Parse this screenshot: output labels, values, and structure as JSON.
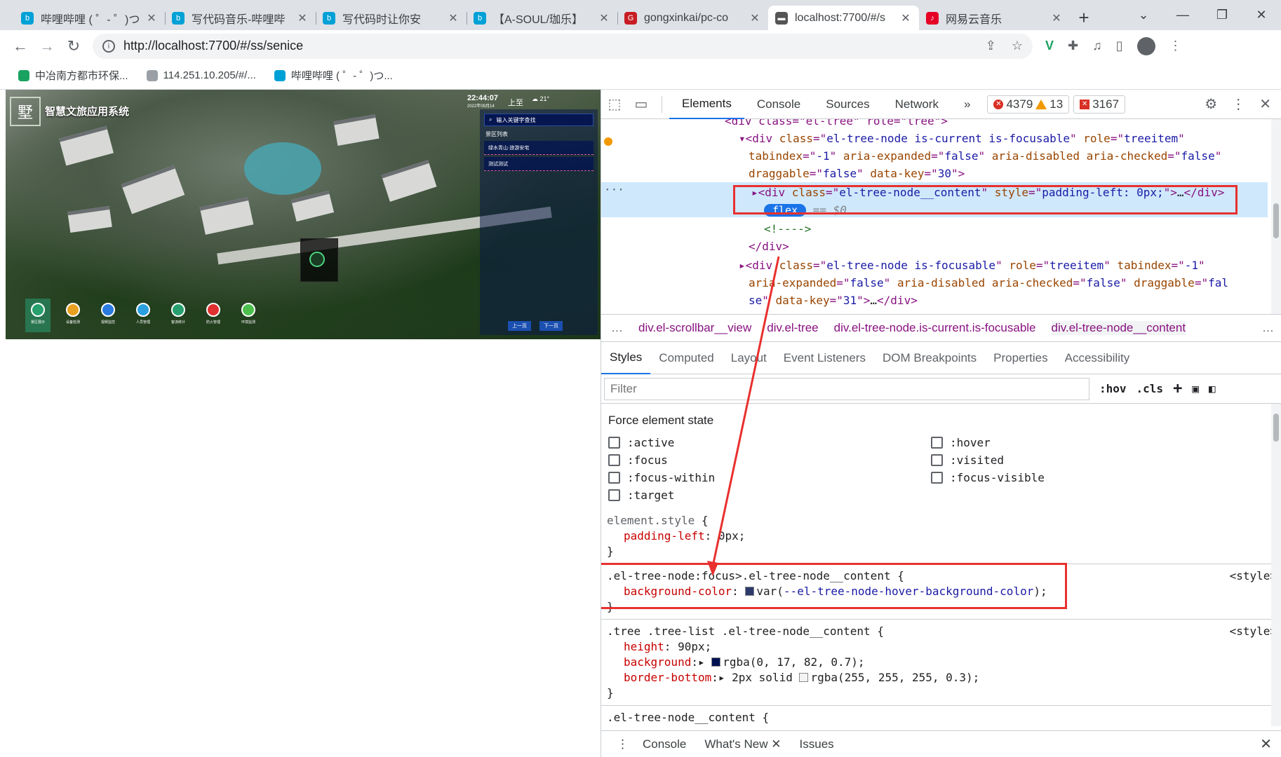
{
  "tabs": [
    {
      "title": "哔哩哔哩 ( ゜- ゜)つ",
      "fav_color": "#00a1d6",
      "fav": "b"
    },
    {
      "title": "写代码音乐-哔哩哔",
      "fav_color": "#00a1d6",
      "fav": "b"
    },
    {
      "title": "写代码时让你安",
      "fav_color": "#00a1d6",
      "fav": "b"
    },
    {
      "title": "【A-SOUL/珈乐】",
      "fav_color": "#00a1d6",
      "fav": "b"
    },
    {
      "title": "gongxinkai/pc-co",
      "fav_color": "#c71d23",
      "fav": "G"
    },
    {
      "title": "localhost:7700/#/s",
      "fav_color": "#555555",
      "fav": "▬"
    },
    {
      "title": "网易云音乐",
      "fav_color": "#e60026",
      "fav": "♪"
    }
  ],
  "active_tab": 5,
  "url": "http://localhost:7700/#/ss/senice",
  "bookmarks": [
    {
      "label": "中冶南方都市环保...",
      "color": "#1aa260"
    },
    {
      "label": "114.251.10.205/#/...",
      "color": "#9aa0a6"
    },
    {
      "label": "哔哩哔哩 ( ゜- ゜)つ...",
      "color": "#00a1d6"
    }
  ],
  "app": {
    "title": "智慧文旅应用系统",
    "time": "22:44:07",
    "date": "2022年09月14",
    "ampm": "上至",
    "temp": "21°",
    "search_placeholder": "输入关键字查找",
    "list_title": "景区列表",
    "list_items": [
      "绿水青山·旅游安宅",
      "测试测试"
    ],
    "prev": "上一页",
    "next": "下一页",
    "dock": [
      "景区展示",
      "设备检测",
      "视频监控",
      "人员管理",
      "客流统计",
      "防火管理",
      "环境监测"
    ]
  },
  "devtools": {
    "tabs": [
      "Elements",
      "Console",
      "Sources",
      "Network"
    ],
    "errors": "4379",
    "warnings": "13",
    "issues": "3167",
    "breadcrumbs": [
      "div.el-scrollbar__view",
      "div.el-tree",
      "div.el-tree-node.is-current.is-focusable",
      "div.el-tree-node__content"
    ],
    "style_tabs": [
      "Styles",
      "Computed",
      "Layout",
      "Event Listeners",
      "DOM Breakpoints",
      "Properties",
      "Accessibility"
    ],
    "filter_placeholder": "Filter",
    "hov": ":hov",
    "cls": ".cls",
    "force_state_title": "Force element state",
    "states": [
      ":active",
      ":hover",
      ":focus",
      ":visited",
      ":focus-within",
      ":focus-visible",
      ":target"
    ],
    "drawer": [
      "Console",
      "What's New",
      "Issues"
    ],
    "source_label": "<style>"
  }
}
